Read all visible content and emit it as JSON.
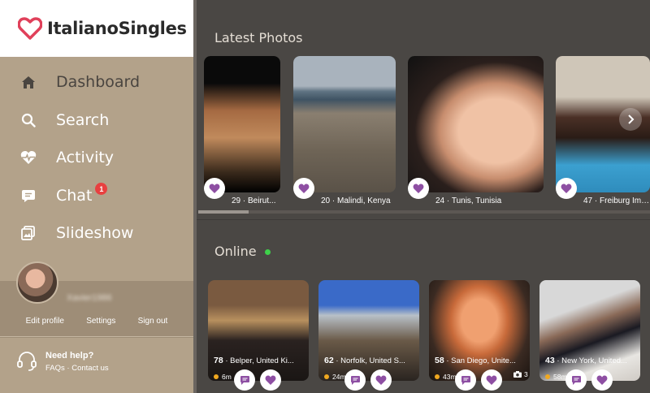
{
  "brand": {
    "name": "ItalianoSingles",
    "accent": "#e0405a"
  },
  "sidebar": {
    "items": [
      {
        "label": "Dashboard",
        "icon": "home-icon",
        "active": true
      },
      {
        "label": "Search",
        "icon": "search-icon",
        "active": false
      },
      {
        "label": "Activity",
        "icon": "heartbeat-icon",
        "active": false
      },
      {
        "label": "Chat",
        "icon": "chat-icon",
        "active": false,
        "badge": "1"
      },
      {
        "label": "Slideshow",
        "icon": "slideshow-icon",
        "active": false
      }
    ],
    "profile": {
      "username": "Xavier1986",
      "links": [
        "Edit profile",
        "Settings",
        "Sign out"
      ]
    },
    "help": {
      "title": "Need help?",
      "faqs": "FAQs",
      "separator": "·",
      "contact": "Contact us"
    }
  },
  "latest_photos": {
    "title": "Latest Photos",
    "cards": [
      {
        "caption": "29 · Beirut..."
      },
      {
        "caption": "20 · Malindi, Kenya"
      },
      {
        "caption": "24 · Tunis, Tunisia"
      },
      {
        "caption": "47 · Freiburg Im B..."
      }
    ]
  },
  "online": {
    "title": "Online",
    "cards": [
      {
        "age": "78",
        "location": "· Belper, United Ki...",
        "time": "6m",
        "photos": ""
      },
      {
        "age": "62",
        "location": "· Norfolk, United S...",
        "time": "24m",
        "photos": ""
      },
      {
        "age": "58",
        "location": "· San Diego, Unite...",
        "time": "43m",
        "photos": "3"
      },
      {
        "age": "43",
        "location": "· New York, United...",
        "time": "58m",
        "photos": ""
      }
    ]
  },
  "colors": {
    "heart": "#8e4fa3",
    "online_dot": "#3ed14a",
    "badge": "#e84040"
  }
}
